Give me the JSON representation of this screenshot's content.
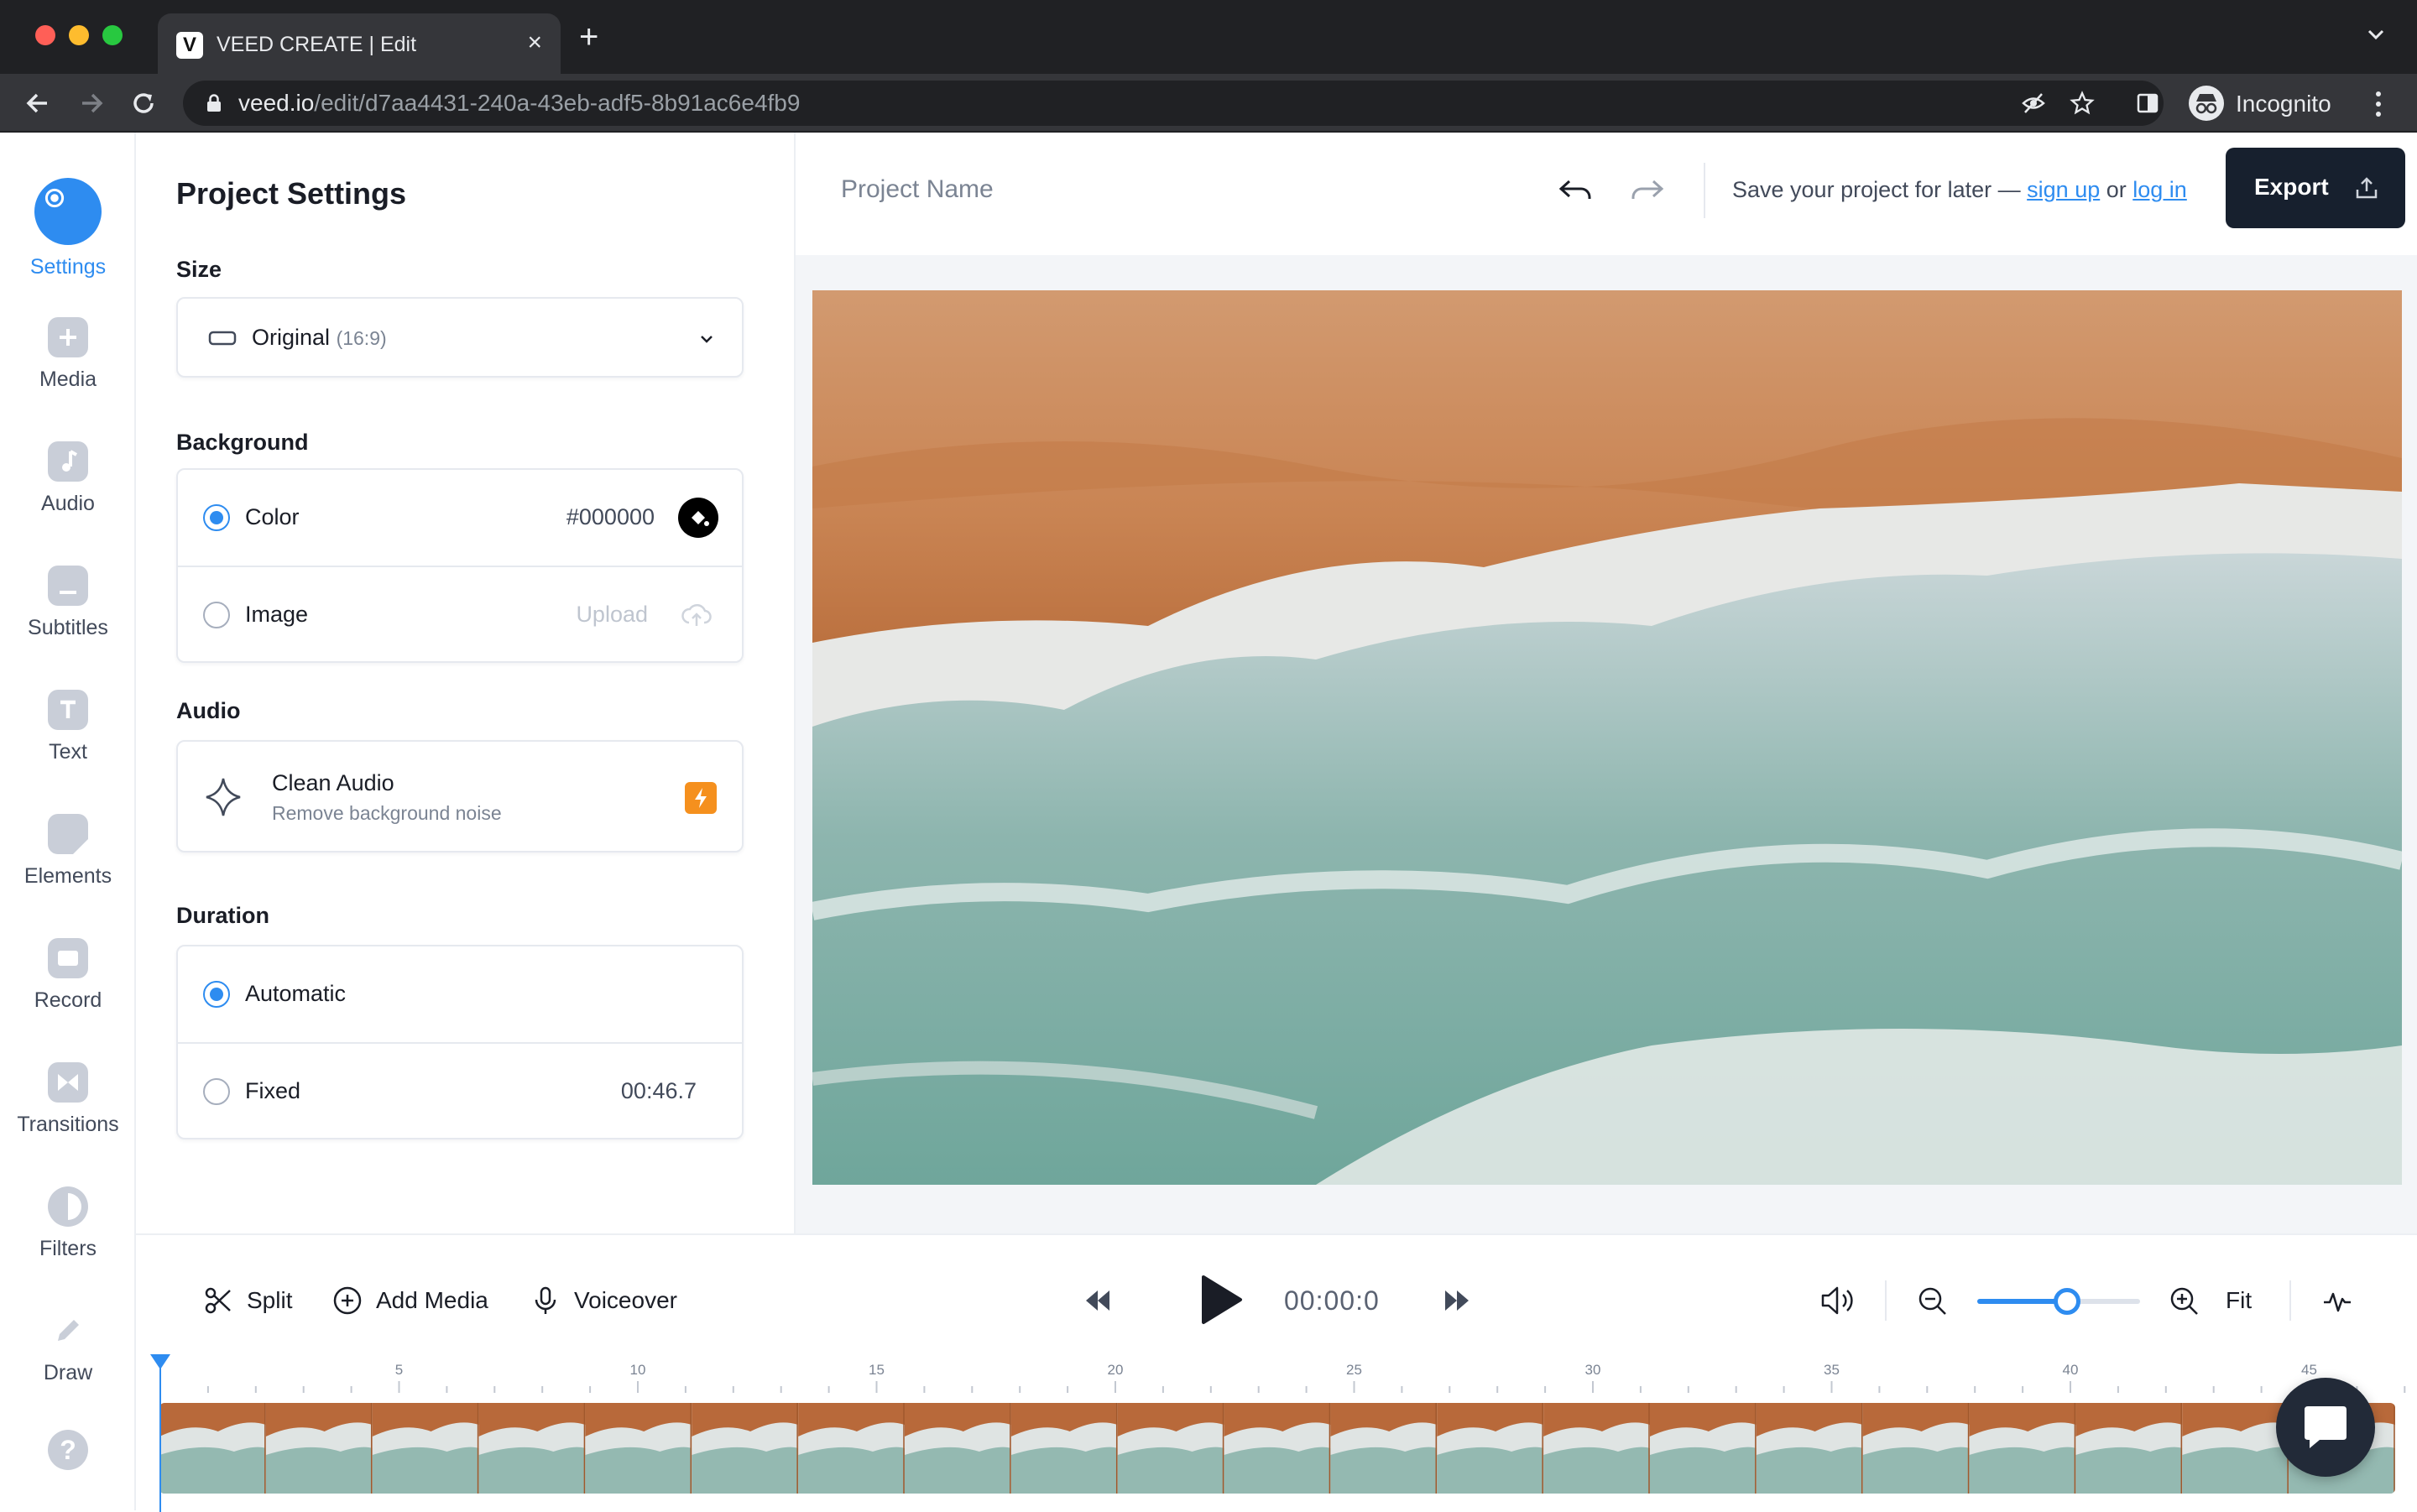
{
  "browser": {
    "tab_title": "VEED CREATE | Edit",
    "tab_favicon": "V",
    "tab_close": "×",
    "new_tab": "+",
    "url_host": "veed.io",
    "url_path": "/edit/d7aa4431-240a-43eb-adf5-8b91ac6e4fb9",
    "profile_label": "Incognito"
  },
  "sidebar": {
    "items": [
      {
        "label": "Settings",
        "icon": "settings-icon",
        "active": true
      },
      {
        "label": "Media",
        "icon": "plus-icon"
      },
      {
        "label": "Audio",
        "icon": "music-note-icon"
      },
      {
        "label": "Subtitles",
        "icon": "subtitles-icon"
      },
      {
        "label": "Text",
        "icon": "text-icon"
      },
      {
        "label": "Elements",
        "icon": "elements-icon"
      },
      {
        "label": "Record",
        "icon": "record-icon"
      },
      {
        "label": "Transitions",
        "icon": "transitions-icon"
      },
      {
        "label": "Filters",
        "icon": "filters-icon"
      },
      {
        "label": "Draw",
        "icon": "pencil-icon"
      }
    ],
    "help": "?"
  },
  "settings": {
    "title": "Project Settings",
    "size": {
      "label": "Size",
      "selected": "Original",
      "ratio": "(16:9)"
    },
    "background": {
      "label": "Background",
      "color_label": "Color",
      "color_value": "#000000",
      "image_label": "Image",
      "upload_label": "Upload",
      "selected": "color"
    },
    "audio": {
      "label": "Audio",
      "clean_title": "Clean Audio",
      "clean_subtitle": "Remove background noise"
    },
    "duration": {
      "label": "Duration",
      "automatic_label": "Automatic",
      "fixed_label": "Fixed",
      "fixed_value": "00:46.7",
      "selected": "automatic"
    }
  },
  "topbar": {
    "project_name": "Project Name",
    "save_prefix": "Save your project for later — ",
    "sign_up": "sign up",
    "save_mid": " or ",
    "log_in": "log in",
    "export_label": "Export"
  },
  "toolbar": {
    "split": "Split",
    "add_media": "Add Media",
    "voiceover": "Voiceover",
    "timecode": "00:00:0",
    "fit": "Fit",
    "zoom_level": 0.55
  },
  "timeline": {
    "ticks": [
      "5",
      "10",
      "15",
      "20",
      "25",
      "30",
      "35",
      "40",
      "45"
    ],
    "thumbnail_count": 21
  },
  "colors": {
    "accent": "#2e8cf0",
    "export_bg": "#17202e",
    "lightning_badge": "#f5901e"
  }
}
